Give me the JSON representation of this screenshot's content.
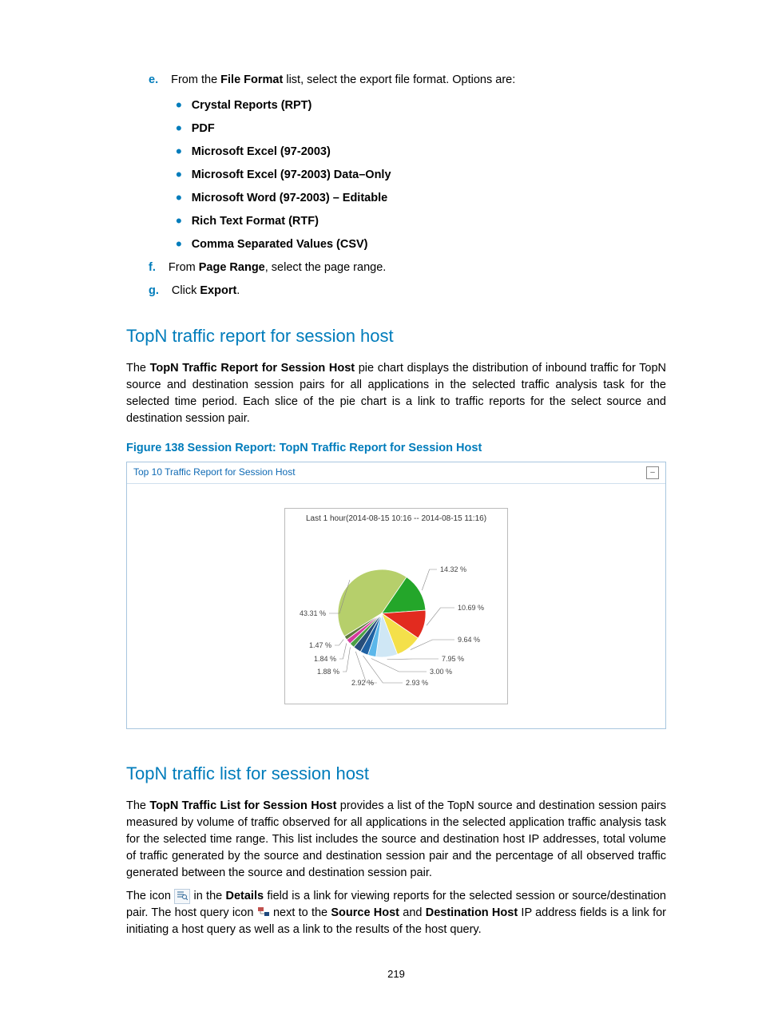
{
  "steps": {
    "e": {
      "mk": "e.",
      "lead": "From the ",
      "b": "File Format",
      "tail": " list, select the export file format. Options are:"
    },
    "f": {
      "mk": "f.",
      "lead": "From ",
      "b": "Page Range",
      "tail": ", select the page range."
    },
    "g": {
      "mk": "g.",
      "lead": "Click ",
      "b": "Export",
      "tail": "."
    }
  },
  "formats": [
    "Crystal Reports (RPT)",
    "PDF",
    "Microsoft Excel (97-2003)",
    "Microsoft Excel (97-2003) Data–Only",
    "Microsoft Word (97-2003) – Editable",
    "Rich Text Format (RTF)",
    "Comma Separated Values (CSV)"
  ],
  "h2a": "TopN traffic report for session host",
  "p1a": "The ",
  "p1b": "TopN Traffic Report for Session Host",
  "p1c": " pie chart displays the distribution of inbound traffic for TopN source and destination session pairs for all applications in the selected traffic analysis task for the selected time period. Each slice of the pie chart is a link to traffic reports for the select source and destination session pair.",
  "figcap": "Figure 138 Session Report: TopN Traffic Report for Session Host",
  "chart_header": "Top 10 Traffic Report for Session Host",
  "collapse": "–",
  "chart_title": "Last 1 hour(2014-08-15 10:16 -- 2014-08-15 11:16)",
  "h2b": "TopN traffic list for session host",
  "p2a": "The ",
  "p2b": "TopN Traffic List for Session Host",
  "p2c": " provides a list of the TopN source and destination session pairs measured by volume of traffic observed for all applications in the selected application traffic analysis task for the selected time range. This list includes the source and destination host IP addresses, total volume of traffic generated by the source and destination session pair and the percentage of all observed traffic generated between the source and destination session pair.",
  "p3a": "The icon ",
  "p3b": " in the ",
  "p3c": "Details",
  "p3d": " field is a link for viewing reports for the selected session or source/destination pair. The host query icon ",
  "p3e": " next to the ",
  "p3f": "Source Host",
  "p3g": " and ",
  "p3h": "Destination Host",
  "p3i": " IP address fields is a link for initiating a host query as well as a link to the results of the host query.",
  "pagenum": "219",
  "chart_data": {
    "type": "pie",
    "title": "Last 1 hour(2014-08-15 10:16 -- 2014-08-15 11:16)",
    "series": [
      {
        "label": "43.31 %",
        "value": 43.31,
        "color": "#b6cf6b"
      },
      {
        "label": "14.32 %",
        "value": 14.32,
        "color": "#24a62a"
      },
      {
        "label": "10.69 %",
        "value": 10.69,
        "color": "#e22b1f"
      },
      {
        "label": "9.64 %",
        "value": 9.64,
        "color": "#f4e04a"
      },
      {
        "label": "7.95 %",
        "value": 7.95,
        "color": "#cfe7f5"
      },
      {
        "label": "3.00 %",
        "value": 3.0,
        "color": "#5bb7ea"
      },
      {
        "label": "2.93 %",
        "value": 2.93,
        "color": "#1f61a3"
      },
      {
        "label": "2.92 %",
        "value": 2.92,
        "color": "#274d7a"
      },
      {
        "label": "1.88 %",
        "value": 1.88,
        "color": "#4a9f45"
      },
      {
        "label": "1.84 %",
        "value": 1.84,
        "color": "#d53a9d"
      },
      {
        "label": "1.47 %",
        "value": 1.47,
        "color": "#5c7a3a"
      }
    ]
  }
}
